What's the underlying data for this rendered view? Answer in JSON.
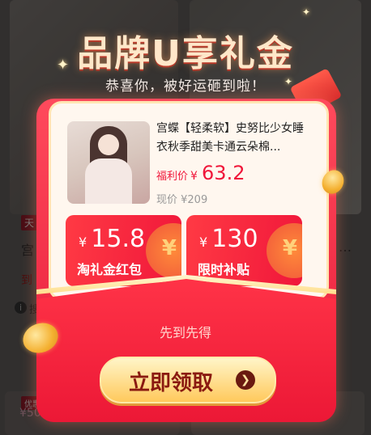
{
  "header": {
    "title": "品牌U享礼金",
    "subtitle": "恭喜你，被好运砸到啦！"
  },
  "product": {
    "title": "宫蝶【轻柔软】史努比少女睡衣秋季甜美卡通云朵棉...",
    "price_label": "福利价",
    "currency": "¥",
    "price": "63.2",
    "original_price": "现价 ¥209"
  },
  "coupons": [
    {
      "currency": "¥",
      "amount": "15.8",
      "label": "淘礼金红包"
    },
    {
      "currency": "¥",
      "amount": "130",
      "label": "限时补贴"
    }
  ],
  "pocket_text": "先到先得",
  "cta": {
    "label": "立即领取",
    "arrow": "❯"
  },
  "background": {
    "tag1": "天",
    "text1": "宫",
    "text2": "到",
    "tag2": "优惠",
    "price2": "¥50",
    "info_icon": "i",
    "info_text": "搜",
    "ellipsis": "…"
  },
  "colors": {
    "envelope": "#e61a38",
    "price": "#f0163a",
    "cta": "#ffc95c"
  }
}
